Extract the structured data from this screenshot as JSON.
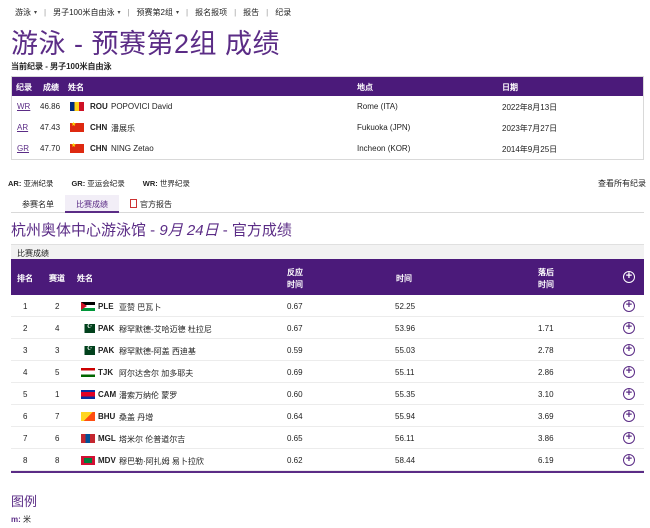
{
  "breadcrumb": {
    "items": [
      "游泳",
      "男子100米自由泳",
      "预赛第2组",
      "报名报项",
      "报告",
      "纪录"
    ]
  },
  "page_title": "游泳 - 预赛第2组 成绩",
  "sub_title": "当前纪录 - 男子100米自由泳",
  "records": {
    "headers": {
      "record": "纪录",
      "result": "成绩",
      "name": "姓名",
      "place": "地点",
      "date": "日期"
    },
    "rows": [
      {
        "code": "WR",
        "result": "46.86",
        "noc": "ROU",
        "name": "POPOVICI David",
        "place": "Rome (ITA)",
        "date": "2022年8月13日",
        "flag": "rou"
      },
      {
        "code": "AR",
        "result": "47.43",
        "noc": "CHN",
        "name": "潘展乐",
        "place": "Fukuoka (JPN)",
        "date": "2023年7月27日",
        "flag": "chn"
      },
      {
        "code": "GR",
        "result": "47.70",
        "noc": "CHN",
        "name": "NING Zetao",
        "place": "Incheon (KOR)",
        "date": "2014年9月25日",
        "flag": "chn"
      }
    ]
  },
  "abbrev": [
    {
      "code": "AR:",
      "text": "亚洲纪录"
    },
    {
      "code": "GR:",
      "text": "亚运会纪录"
    },
    {
      "code": "WR:",
      "text": "世界纪录"
    }
  ],
  "all_records_link": "查看所有纪录",
  "tabs": {
    "start_list": "参赛名单",
    "results": "比赛成绩",
    "official_report": "官方报告"
  },
  "venue": {
    "place": "杭州奥体中心游泳馆",
    "date": "9月 24日",
    "suffix": "官方成绩",
    "sep": " - "
  },
  "section_label": "比赛成绩",
  "results": {
    "headers": {
      "rank": "排名",
      "lane": "赛道",
      "name": "姓名",
      "reaction_1": "反应",
      "reaction_2": "时间",
      "time": "时间",
      "behind_1": "落后",
      "behind_2": "时间"
    },
    "rows": [
      {
        "rank": "1",
        "lane": "2",
        "noc": "PLE",
        "name": "亚赞 巴瓦卜",
        "reaction": "0.67",
        "time": "52.25",
        "behind": "",
        "flag": "f-ple"
      },
      {
        "rank": "2",
        "lane": "4",
        "noc": "PAK",
        "name": "穆罕默德-艾哈迈德 杜拉尼",
        "reaction": "0.67",
        "time": "53.96",
        "behind": "1.71",
        "flag": "f-pak"
      },
      {
        "rank": "3",
        "lane": "3",
        "noc": "PAK",
        "name": "穆罕默德-阿盖 西迪基",
        "reaction": "0.59",
        "time": "55.03",
        "behind": "2.78",
        "flag": "f-pak"
      },
      {
        "rank": "4",
        "lane": "5",
        "noc": "TJK",
        "name": "阿尔达舍尔 加多耶夫",
        "reaction": "0.69",
        "time": "55.11",
        "behind": "2.86",
        "flag": "f-tjk"
      },
      {
        "rank": "5",
        "lane": "1",
        "noc": "CAM",
        "name": "潘索万纳伦 蒙罗",
        "reaction": "0.60",
        "time": "55.35",
        "behind": "3.10",
        "flag": "f-cam"
      },
      {
        "rank": "6",
        "lane": "7",
        "noc": "BHU",
        "name": "桑盖 丹增",
        "reaction": "0.64",
        "time": "55.94",
        "behind": "3.69",
        "flag": "f-bhu"
      },
      {
        "rank": "7",
        "lane": "6",
        "noc": "MGL",
        "name": "塔米尔 伦普道尔吉",
        "reaction": "0.65",
        "time": "56.11",
        "behind": "3.86",
        "flag": "f-mgl"
      },
      {
        "rank": "8",
        "lane": "8",
        "noc": "MDV",
        "name": "穆巴勒·阿扎姆 易卜拉欣",
        "reaction": "0.62",
        "time": "58.44",
        "behind": "6.19",
        "flag": "f-mdv"
      }
    ]
  },
  "legend": {
    "title": "图例",
    "code": "m:",
    "text": "米"
  },
  "colors": {
    "accent": "#5b2c86",
    "header_bg": "#4b1a7a"
  }
}
